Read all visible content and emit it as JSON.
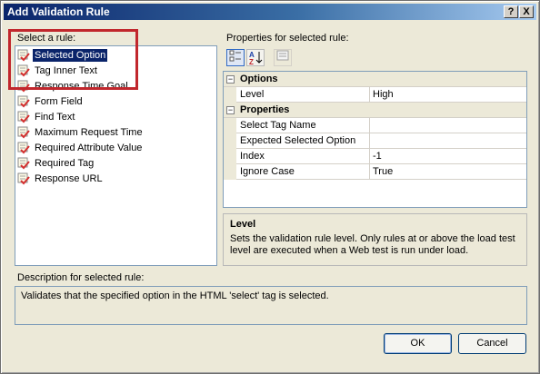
{
  "window": {
    "title": "Add Validation Rule",
    "help_button": "?",
    "close_button": "X"
  },
  "rules_panel": {
    "label": "Select a rule:",
    "items": [
      {
        "label": "Selected Option",
        "selected": true
      },
      {
        "label": "Tag Inner Text",
        "selected": false
      },
      {
        "label": "Response Time Goal",
        "selected": false
      },
      {
        "label": "Form Field",
        "selected": false
      },
      {
        "label": "Find Text",
        "selected": false
      },
      {
        "label": "Maximum Request Time",
        "selected": false
      },
      {
        "label": "Required Attribute Value",
        "selected": false
      },
      {
        "label": "Required Tag",
        "selected": false
      },
      {
        "label": "Response URL",
        "selected": false
      }
    ]
  },
  "properties_panel": {
    "label": "Properties for selected rule:",
    "categories": [
      {
        "name": "Options",
        "toggle": "−",
        "rows": [
          {
            "name": "Level",
            "value": "High"
          }
        ]
      },
      {
        "name": "Properties",
        "toggle": "−",
        "rows": [
          {
            "name": "Select Tag Name",
            "value": ""
          },
          {
            "name": "Expected Selected Option",
            "value": ""
          },
          {
            "name": "Index",
            "value": "-1"
          },
          {
            "name": "Ignore Case",
            "value": "True"
          }
        ]
      }
    ],
    "help_title": "Level",
    "help_text": "Sets the validation rule level.  Only rules at or above the load test level are executed when a Web test is run under load."
  },
  "description_panel": {
    "label": "Description for selected rule:",
    "text": "Validates that the specified option in the HTML 'select' tag is selected."
  },
  "buttons": {
    "ok": "OK",
    "cancel": "Cancel"
  },
  "colors": {
    "selection": "#0a246a",
    "highlight_box": "#c1272d",
    "rule_icon_check": "#d32f2f"
  }
}
